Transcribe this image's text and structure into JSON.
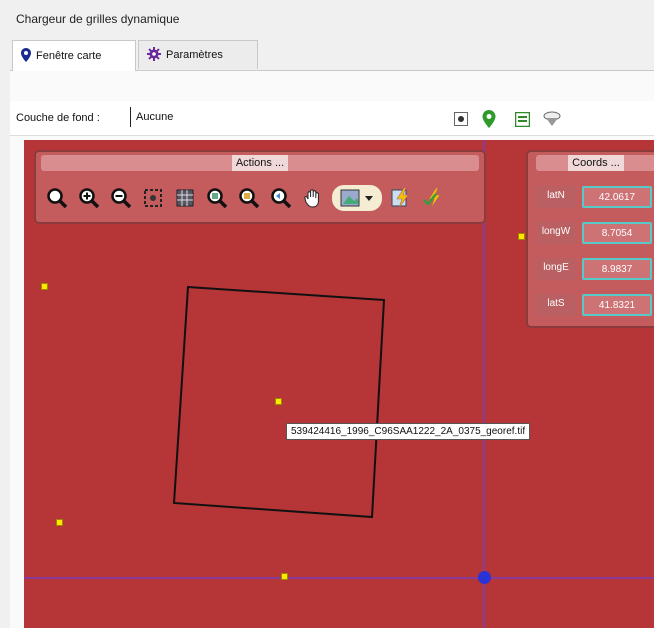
{
  "window": {
    "title": "Chargeur de grilles dynamique"
  },
  "tabs": [
    {
      "label": "Fenêtre carte",
      "icon": "map-pin-icon",
      "active": true
    },
    {
      "label": "Paramètres",
      "icon": "gear-icon",
      "active": false
    }
  ],
  "basemap": {
    "label": "Couche de fond :",
    "value": "Aucune"
  },
  "toolbar_icons": [
    "crosshair-icon",
    "map-pin-icon",
    "layer-panel-icon",
    "basemap-icon"
  ],
  "actions_panel": {
    "title": "Actions ...",
    "tools": [
      "zoom-icon",
      "zoom-in-icon",
      "zoom-out-icon",
      "select-features-icon",
      "grid-icon",
      "zoom-layer-icon",
      "zoom-selection-icon",
      "zoom-previous-icon",
      "pan-hand-icon",
      "georef-select-icon",
      "flash-icon",
      "flash-check-icon"
    ]
  },
  "coords_panel": {
    "title": "Coords ...",
    "rows": [
      {
        "label": "latN",
        "value": "42.0617"
      },
      {
        "label": "longW",
        "value": "8.7054"
      },
      {
        "label": "longE",
        "value": "8.9837"
      },
      {
        "label": "latS",
        "value": "41.8321"
      }
    ]
  },
  "map": {
    "background": "#b63537",
    "crosshair_color": "#8a3a9a",
    "tooltip": "539424416_1996_C96SAA1222_2A_0375_georef.tif"
  }
}
